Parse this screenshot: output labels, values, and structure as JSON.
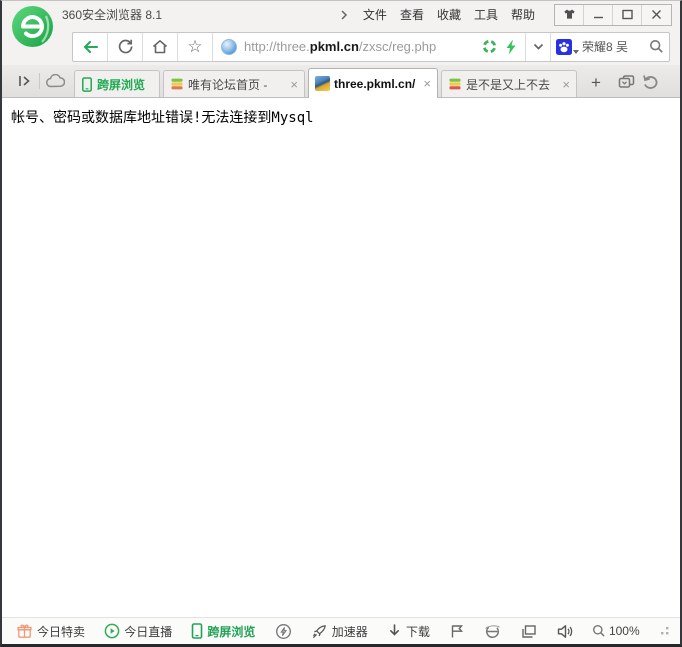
{
  "window": {
    "title": "360安全浏览器 8.1",
    "menus": [
      "文件",
      "查看",
      "收藏",
      "工具",
      "帮助"
    ]
  },
  "toolbar": {
    "url_prefix": "http://three.",
    "url_domain": "pkml.cn",
    "url_path": "/zxsc/reg.php",
    "search_query": "荣耀8 吴"
  },
  "tabbar": {
    "tabs": [
      {
        "label": "跨屏浏览"
      },
      {
        "label": "唯有论坛首页 -"
      },
      {
        "label": "three.pkml.cn/"
      },
      {
        "label": "是不是又上不去"
      }
    ]
  },
  "page": {
    "error_text": "帐号、密码或数据库地址错误!无法连接到Mysql"
  },
  "statusbar": {
    "today_sale": "今日特卖",
    "today_live": "今日直播",
    "cross_screen": "跨屏浏览",
    "accelerator": "加速器",
    "download": "下载",
    "zoom_level": "100%"
  },
  "icons": {
    "close_glyph": "×",
    "plus_glyph": "+",
    "star_glyph": "☆"
  },
  "colors": {
    "accent_green": "#21a356",
    "baidu_blue": "#2932e1",
    "tab_active_bg": "#ffffff",
    "chrome_bg": "#f3f2f1"
  }
}
